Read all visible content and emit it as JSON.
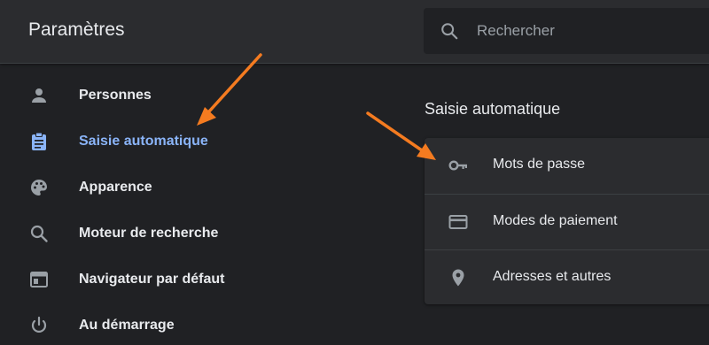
{
  "header": {
    "title": "Paramètres",
    "search": {
      "placeholder": "Rechercher",
      "value": ""
    }
  },
  "sidebar": {
    "items": [
      {
        "label": "Personnes",
        "icon": "person-icon",
        "active": false
      },
      {
        "label": "Saisie automatique",
        "icon": "clipboard-icon",
        "active": true
      },
      {
        "label": "Apparence",
        "icon": "palette-icon",
        "active": false
      },
      {
        "label": "Moteur de recherche",
        "icon": "search-icon",
        "active": false
      },
      {
        "label": "Navigateur par défaut",
        "icon": "browser-icon",
        "active": false
      },
      {
        "label": "Au démarrage",
        "icon": "power-icon",
        "active": false
      }
    ]
  },
  "main": {
    "section_title": "Saisie automatique",
    "rows": [
      {
        "label": "Mots de passe",
        "icon": "key-icon"
      },
      {
        "label": "Modes de paiement",
        "icon": "credit-card-icon"
      },
      {
        "label": "Adresses et autres",
        "icon": "location-pin-icon"
      }
    ]
  },
  "colors": {
    "background": "#202124",
    "header": "#2b2c2f",
    "accent": "#8ab4f8",
    "icon": "#9aa0a6",
    "annotation_arrow": "#f47b20"
  }
}
